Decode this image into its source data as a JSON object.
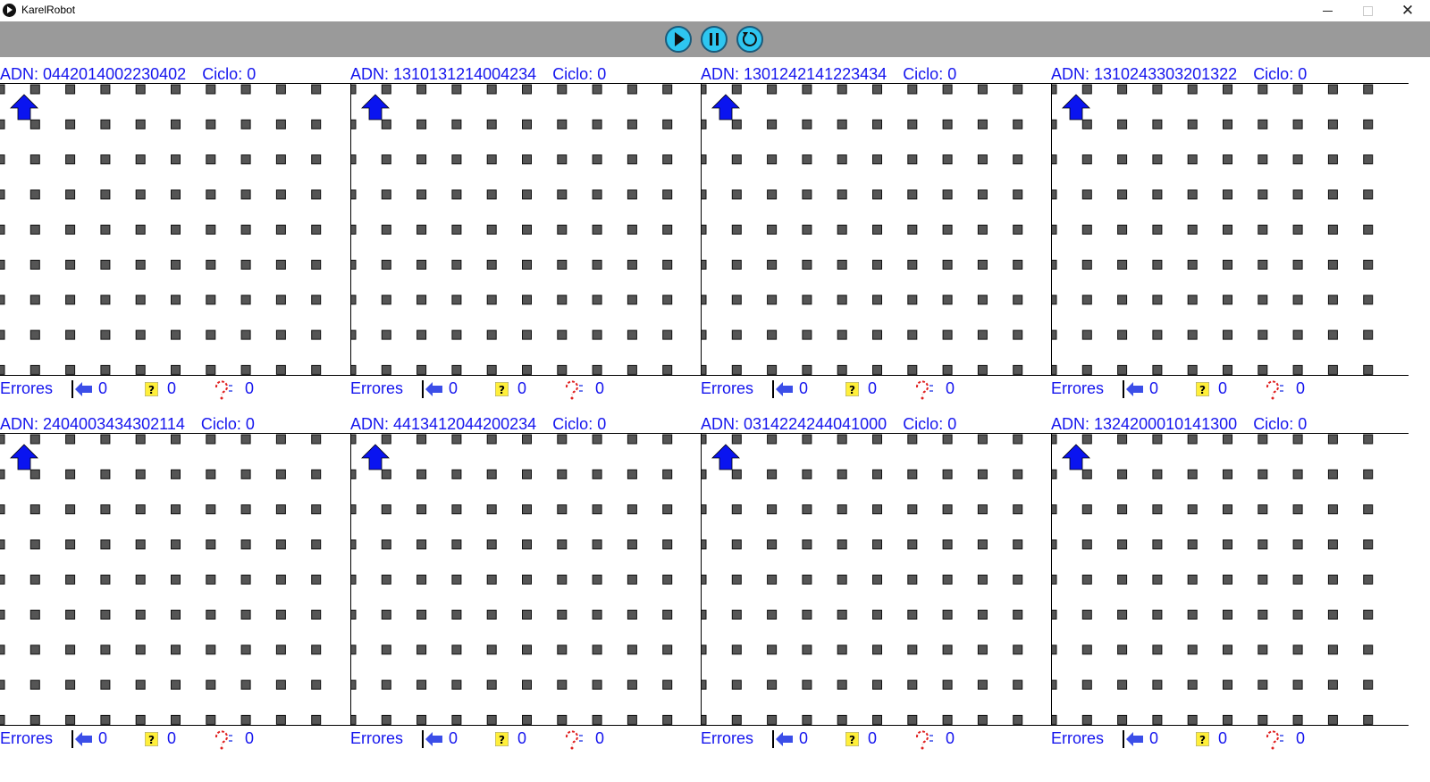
{
  "window": {
    "title": "KarelRobot"
  },
  "toolbar": {
    "play_icon": "play-icon",
    "pause_icon": "pause-icon",
    "reset_icon": "reset-icon"
  },
  "labels": {
    "adn_prefix": "ADN: ",
    "ciclo_prefix": "Ciclo: ",
    "errors": "Errores"
  },
  "colors": {
    "label_blue": "#1515ee",
    "robot_blue": "#0a14f0",
    "toolbar_bg": "#9a9a9a",
    "button_cyan": "#2ec6f0",
    "grid_dot": "#555555"
  },
  "robots": [
    {
      "adn": "0442014002230402",
      "ciclo": "0",
      "wall_errors": "0",
      "unknown_errors": "0",
      "lost_errors": "0"
    },
    {
      "adn": "1310131214004234",
      "ciclo": "0",
      "wall_errors": "0",
      "unknown_errors": "0",
      "lost_errors": "0"
    },
    {
      "adn": "1301242141223434",
      "ciclo": "0",
      "wall_errors": "0",
      "unknown_errors": "0",
      "lost_errors": "0"
    },
    {
      "adn": "1310243303201322",
      "ciclo": "0",
      "wall_errors": "0",
      "unknown_errors": "0",
      "lost_errors": "0"
    },
    {
      "adn": "2404003434302114",
      "ciclo": "0",
      "wall_errors": "0",
      "unknown_errors": "0",
      "lost_errors": "0"
    },
    {
      "adn": "4413412044200234",
      "ciclo": "0",
      "wall_errors": "0",
      "unknown_errors": "0",
      "lost_errors": "0"
    },
    {
      "adn": "0314224244041000",
      "ciclo": "0",
      "wall_errors": "0",
      "unknown_errors": "0",
      "lost_errors": "0"
    },
    {
      "adn": "1324200010141300",
      "ciclo": "0",
      "wall_errors": "0",
      "unknown_errors": "0",
      "lost_errors": "0"
    }
  ]
}
